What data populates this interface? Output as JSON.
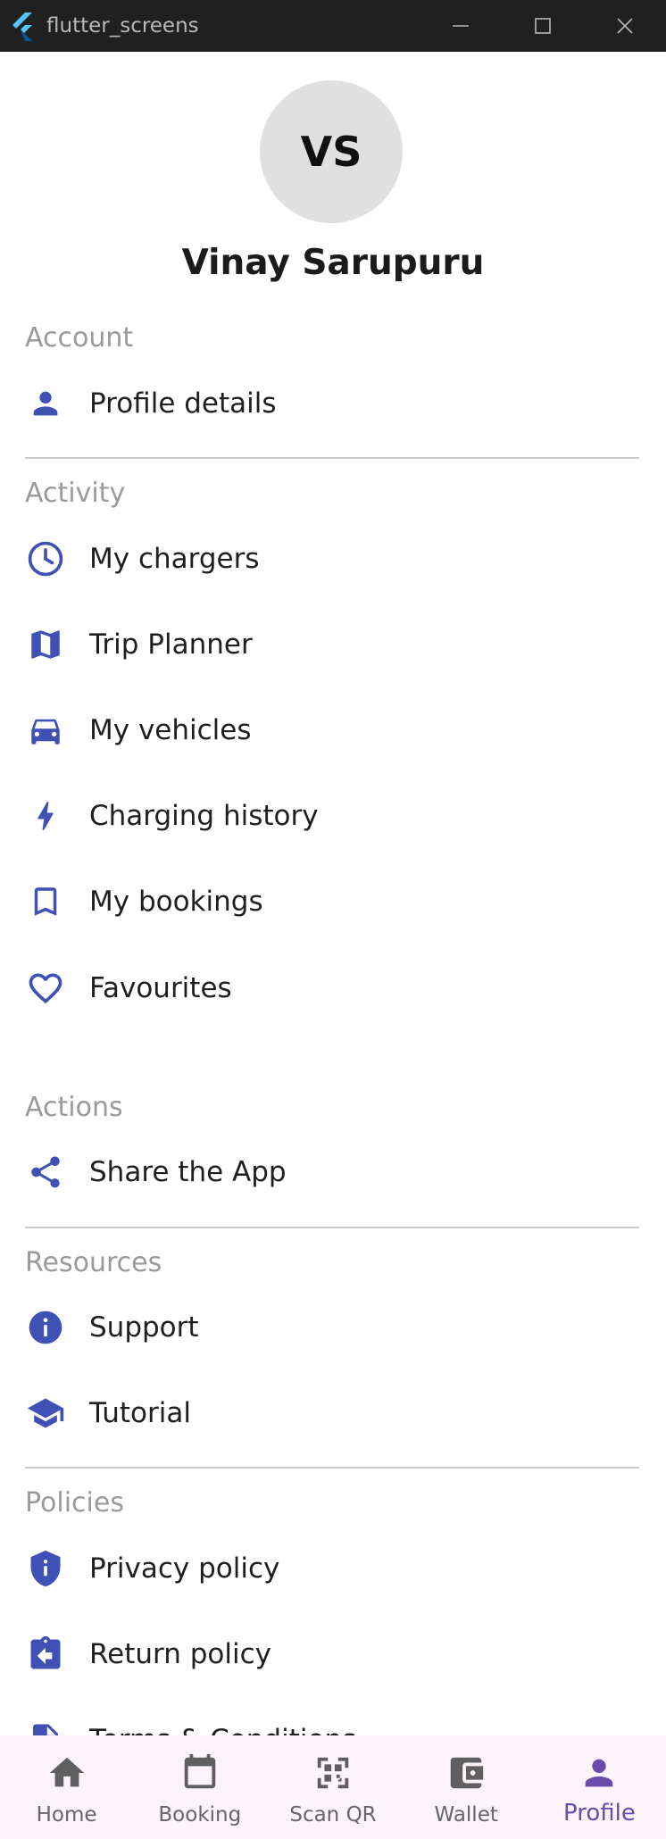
{
  "window": {
    "title": "flutter_screens"
  },
  "profile": {
    "initials": "VS",
    "name": "Vinay Sarupuru"
  },
  "sections": {
    "account": {
      "label": "Account",
      "items": [
        {
          "label": "Profile details",
          "icon": "person-icon"
        }
      ]
    },
    "activity": {
      "label": "Activity",
      "items": [
        {
          "label": "My chargers",
          "icon": "clock-icon"
        },
        {
          "label": "Trip Planner",
          "icon": "map-icon"
        },
        {
          "label": "My vehicles",
          "icon": "car-icon"
        },
        {
          "label": "Charging history",
          "icon": "bolt-icon"
        },
        {
          "label": "My bookings",
          "icon": "bookmark-icon"
        },
        {
          "label": "Favourites",
          "icon": "heart-icon"
        }
      ]
    },
    "actions": {
      "label": "Actions",
      "items": [
        {
          "label": "Share the App",
          "icon": "share-icon"
        }
      ]
    },
    "resources": {
      "label": "Resources",
      "items": [
        {
          "label": "Support",
          "icon": "info-icon"
        },
        {
          "label": "Tutorial",
          "icon": "school-icon"
        }
      ]
    },
    "policies": {
      "label": "Policies",
      "items": [
        {
          "label": "Privacy policy",
          "icon": "shield-info-icon"
        },
        {
          "label": "Return policy",
          "icon": "assignment-return-icon"
        },
        {
          "label": "Terms & Conditions",
          "icon": "document-icon"
        }
      ]
    }
  },
  "bottom_nav": {
    "items": [
      {
        "label": "Home",
        "icon": "home-icon"
      },
      {
        "label": "Booking",
        "icon": "calendar-icon"
      },
      {
        "label": "Scan QR",
        "icon": "qr-code-icon"
      },
      {
        "label": "Wallet",
        "icon": "wallet-icon"
      },
      {
        "label": "Profile",
        "icon": "person-icon"
      }
    ],
    "active": "Profile"
  },
  "colors": {
    "icon_accent": "#3f51b5",
    "nav_active": "#6a4aaa",
    "nav_inactive": "#666666",
    "section_label": "#9a9a9a",
    "nav_background": "#fcf3fb",
    "titlebar": "#202020"
  }
}
